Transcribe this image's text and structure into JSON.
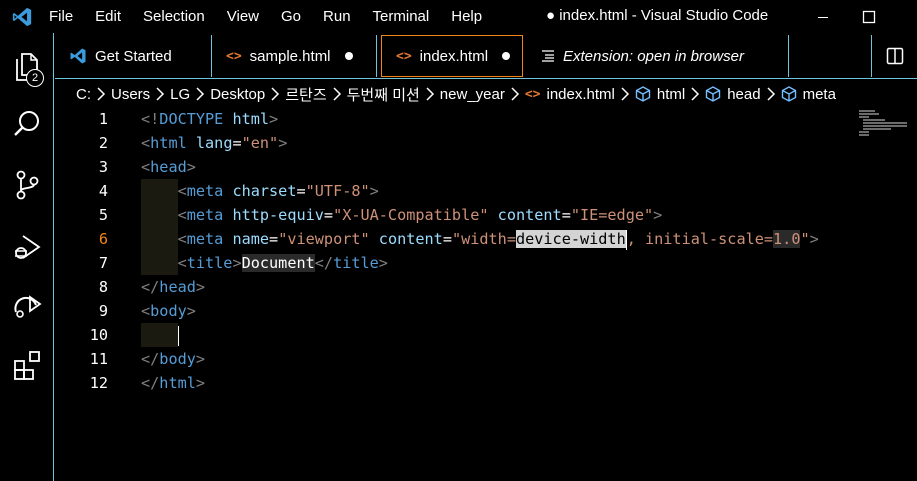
{
  "menu": [
    "File",
    "Edit",
    "Selection",
    "View",
    "Go",
    "Run",
    "Terminal",
    "Help"
  ],
  "window_title": "● index.html - Visual Studio Code",
  "activity": {
    "icons": [
      "explorer-icon",
      "search-icon",
      "source-control-icon",
      "run-debug-icon",
      "remote-icon",
      "extensions-icon"
    ],
    "explorer_badge": "2"
  },
  "tabs": [
    {
      "label": "Get Started",
      "icon": "vscode-logo-icon",
      "dirty": false,
      "active": false,
      "italic": false
    },
    {
      "label": "sample.html",
      "icon": "html-icon",
      "dirty": true,
      "active": false,
      "italic": false
    },
    {
      "label": "index.html",
      "icon": "html-icon",
      "dirty": true,
      "active": true,
      "italic": false
    },
    {
      "label": "Extension: open in browser",
      "icon": "preview-icon",
      "dirty": false,
      "active": false,
      "italic": true
    }
  ],
  "breadcrumb": [
    "C:",
    "Users",
    "LG",
    "Desktop",
    "르탄즈",
    "두번째 미션",
    "new_year",
    "index.html",
    "html",
    "head",
    "meta"
  ],
  "editor": {
    "current_line": "6",
    "line_numbers": [
      "1",
      "2",
      "3",
      "4",
      "5",
      "6",
      "7",
      "8",
      "9",
      "10",
      "11",
      "12"
    ],
    "lines": [
      [
        [
          "t-punct",
          "<!"
        ],
        [
          "t-tag",
          "DOCTYPE"
        ],
        [
          "t-txt",
          " "
        ],
        [
          "t-attr",
          "html"
        ],
        [
          "t-punct",
          ">"
        ]
      ],
      [
        [
          "t-punct",
          "<"
        ],
        [
          "t-tag",
          "html"
        ],
        [
          "t-txt",
          " "
        ],
        [
          "t-attr",
          "lang"
        ],
        [
          "t-txt",
          "="
        ],
        [
          "t-str",
          "\"en\""
        ],
        [
          "t-punct",
          ">"
        ]
      ],
      [
        [
          "t-punct",
          "<"
        ],
        [
          "t-tag",
          "head"
        ],
        [
          "t-punct",
          ">"
        ]
      ],
      [
        [
          "t-txt",
          "    "
        ],
        [
          "t-punct",
          "<"
        ],
        [
          "t-tag",
          "meta"
        ],
        [
          "t-txt",
          " "
        ],
        [
          "t-attr",
          "charset"
        ],
        [
          "t-txt",
          "="
        ],
        [
          "t-str",
          "\"UTF-8\""
        ],
        [
          "t-punct",
          ">"
        ]
      ],
      [
        [
          "t-txt",
          "    "
        ],
        [
          "t-punct",
          "<"
        ],
        [
          "t-tag",
          "meta"
        ],
        [
          "t-txt",
          " "
        ],
        [
          "t-attr",
          "http-equiv"
        ],
        [
          "t-txt",
          "="
        ],
        [
          "t-str",
          "\"X-UA-Compatible\""
        ],
        [
          "t-txt",
          " "
        ],
        [
          "t-attr",
          "content"
        ],
        [
          "t-txt",
          "="
        ],
        [
          "t-str",
          "\"IE=edge\""
        ],
        [
          "t-punct",
          ">"
        ]
      ],
      [
        [
          "t-txt",
          "    "
        ],
        [
          "t-punct",
          "<"
        ],
        [
          "t-tag",
          "meta"
        ],
        [
          "t-txt",
          " "
        ],
        [
          "t-attr",
          "name"
        ],
        [
          "t-txt",
          "="
        ],
        [
          "t-str",
          "\"viewport\""
        ],
        [
          "t-txt",
          " "
        ],
        [
          "t-attr",
          "content"
        ],
        [
          "t-txt",
          "="
        ],
        [
          "t-str",
          "\"width="
        ],
        [
          "hl-sel",
          "device-width"
        ],
        [
          "cursor",
          ""
        ],
        [
          "t-str",
          ", initial-scale="
        ],
        [
          "t-str hl-word",
          "1.0"
        ],
        [
          "t-str",
          "\""
        ],
        [
          "t-punct",
          ">"
        ]
      ],
      [
        [
          "t-txt",
          "    "
        ],
        [
          "t-punct",
          "<"
        ],
        [
          "t-tag",
          "title"
        ],
        [
          "t-punct",
          ">"
        ],
        [
          "t-txt hl-word",
          "Document"
        ],
        [
          "t-punct",
          "</"
        ],
        [
          "t-tag",
          "title"
        ],
        [
          "t-punct",
          ">"
        ]
      ],
      [
        [
          "t-punct",
          "</"
        ],
        [
          "t-tag",
          "head"
        ],
        [
          "t-punct",
          ">"
        ]
      ],
      [
        [
          "t-punct",
          "<"
        ],
        [
          "t-tag",
          "body"
        ],
        [
          "t-punct",
          ">"
        ]
      ],
      [
        [
          "t-txt",
          "    "
        ],
        [
          "cursor",
          ""
        ]
      ],
      [
        [
          "t-punct",
          "</"
        ],
        [
          "t-tag",
          "body"
        ],
        [
          "t-punct",
          ">"
        ]
      ],
      [
        [
          "t-punct",
          "</"
        ],
        [
          "t-tag",
          "html"
        ],
        [
          "t-punct",
          ">"
        ]
      ]
    ]
  },
  "colors": {
    "accent_border": "#6fc3df",
    "active_tab_border": "#f38518",
    "tag": "#569cd6",
    "attribute": "#9cdcfe",
    "string": "#ce9178"
  }
}
